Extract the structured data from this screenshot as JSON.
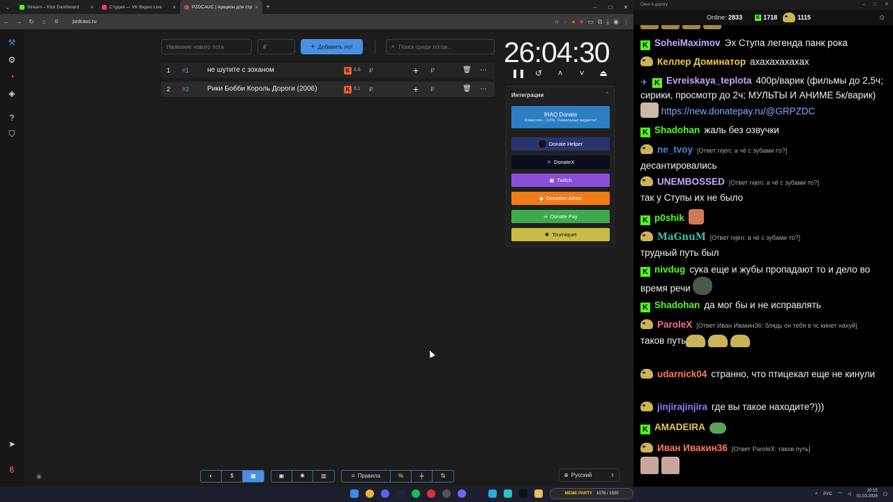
{
  "browser": {
    "tabs": [
      {
        "label": "Stream – Kick Dashboard",
        "color": "#53fc18"
      },
      {
        "label": "Студия — VK Видео Live",
        "color": "#ff3366"
      },
      {
        "label": "PZDCAUC | Аукцион для стри...",
        "color": "#cc4444"
      }
    ],
    "url": "pzdcauc.ru"
  },
  "auction": {
    "new_lot_placeholder": "Название нового лота",
    "price_placeholder": "₽",
    "add_label": "Добавить лот",
    "search_placeholder": "Поиск среди лотов...",
    "lots": [
      {
        "num": "1",
        "id": "#1",
        "name": "не шутите с зоханом",
        "rating": "6.6",
        "currency": "₽"
      },
      {
        "num": "2",
        "id": "#2",
        "name": "Рики Бобби Король Дороги (2006)",
        "rating": "6.1",
        "currency": "₽"
      }
    ],
    "timer": "26:04:30",
    "integrations": {
      "title": "Интеграции",
      "ihaq_title": "IHAQ Donate",
      "ihaq_sub": "Комиссия – 3,5%. Уникальные виджеты!",
      "donate_helper": "Donate Helper",
      "donatex": "DonateX",
      "twitch": "Twitch",
      "donation_alerts": "Donation Alerts",
      "donate_pay": "Donate Pay",
      "tourniquet": "Tourniquet"
    },
    "bottom": {
      "rules": "Правила",
      "percent": "%",
      "language": "Русский"
    }
  },
  "chat": {
    "window_title": "Окно в дорогу",
    "online_label": "Online:",
    "online": "2833",
    "kick_count": "1718",
    "vk_count": "1115",
    "messages": [
      {
        "nick": "SoheiMaximov",
        "text": "Эх Ступа легенда панк рока"
      },
      {
        "nick": "Келлер Доминатор",
        "text": "ахахахахахах"
      },
      {
        "nick": "Evreiskaya_teplota",
        "text": "400р/варик (фильмы до 2,5ч; сирики, просмотр до 2ч; МУЛЬТЫ И АНИМЕ 5к/варик)",
        "link": "https://new.donatepay.ru/@GRPZDC"
      },
      {
        "nick": "Shadohan",
        "text": "жаль без озвучки"
      },
      {
        "nick": "ne_tvoy",
        "reply": "[Ответ nijen: а чё с зубами то?]",
        "text": "десантировались"
      },
      {
        "nick": "UNEMBOSSED",
        "reply": "[Ответ nijen: а чё с зубами то?]",
        "text": "так у Ступы их не было"
      },
      {
        "nick": "p0shik",
        "text": ""
      },
      {
        "nick": "MaGnuM",
        "reply": "[Ответ nijen: а чё с зубами то?]",
        "text": "трудный путь был"
      },
      {
        "nick": "nivdug",
        "text": "сука еще и жубы пропадают то и дело во время речи"
      },
      {
        "nick": "Shadohan",
        "text": "да мог бы и не исправлять"
      },
      {
        "nick": "ParoleX",
        "reply": "[Ответ Иван Ивакин36: блядь он тебя в чс кинет нахуй]",
        "text": "таков путь"
      },
      {
        "nick": "udarnick04",
        "text": "странно, что птицекал еще не кинули"
      },
      {
        "nick": "jinjirajinjira",
        "text": "где вы такое находите?)))"
      },
      {
        "nick": "AMADEIRA",
        "text": ""
      },
      {
        "nick": "Иван Ивакин36",
        "reply": "[Ответ ParoleX: таков путь]",
        "text": ""
      }
    ],
    "colors": {
      "SoheiMaximov": "#c9a6ff",
      "Keller": "#f2c94c",
      "Evreiskaya": "#c9a6ff",
      "Shadohan": "#53fc18",
      "ne_tvoy": "#3d8bd9",
      "UNEMBOSSED": "#c9a6ff",
      "p0shik": "#53fc18",
      "MaGnuM": "#3fbfa8",
      "nivdug": "#53fc18",
      "ParoleX": "#ff6f8a",
      "udarnick04": "#ff7a59",
      "jinjirajinjira": "#8a7dff",
      "AMADEIRA": "#f2c94c",
      "Ivan": "#ff7a59"
    }
  },
  "taskbar": {
    "widget_title": "MEME PARTY",
    "widget_value": "1076 / 1500",
    "lang": "РУС",
    "time": "20:15",
    "date": "01.03.2026"
  }
}
